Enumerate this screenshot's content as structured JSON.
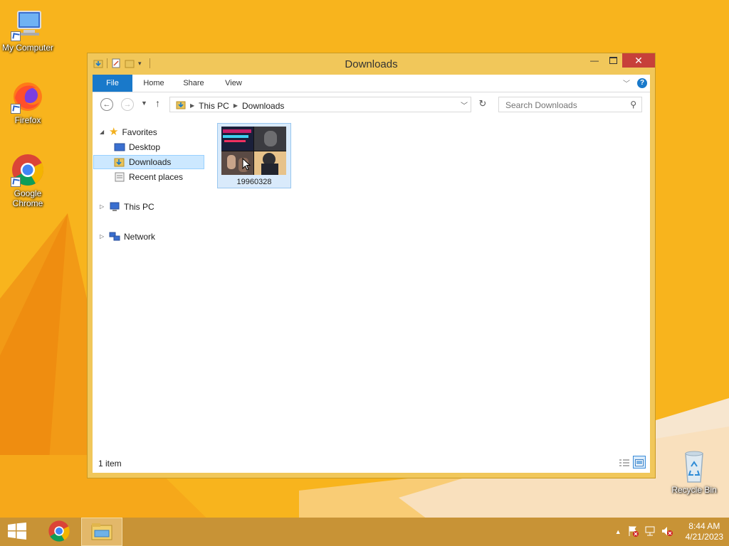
{
  "desktop": {
    "icons": [
      {
        "label": "My Computer",
        "icon": "computer-icon"
      },
      {
        "label": "Firefox",
        "icon": "firefox-icon"
      },
      {
        "label": "Google Chrome",
        "icon": "chrome-icon"
      },
      {
        "label": "Recycle Bin",
        "icon": "recycle-bin-icon"
      }
    ]
  },
  "window": {
    "title": "Downloads",
    "ribbon_tabs": [
      "File",
      "Home",
      "Share",
      "View"
    ],
    "address": {
      "crumbs": [
        "This PC",
        "Downloads"
      ]
    },
    "search": {
      "placeholder": "Search Downloads"
    },
    "nav": {
      "favorites": "Favorites",
      "desktop": "Desktop",
      "downloads": "Downloads",
      "recent": "Recent places",
      "thispc": "This PC",
      "network": "Network"
    },
    "files": [
      {
        "name": "19960328",
        "type": "video-thumbnail"
      }
    ],
    "status": "1 item"
  },
  "taskbar": {
    "time": "8:44 AM",
    "date": "4/21/2023"
  },
  "colors": {
    "accent": "#1979ca",
    "desktop": "#f7b21e",
    "window_frame": "#f1c75a",
    "taskbar": "#c89336",
    "close": "#c7403a"
  }
}
